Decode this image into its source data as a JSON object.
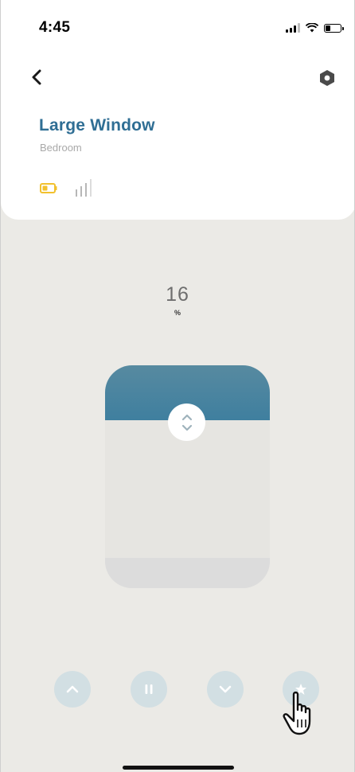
{
  "status_bar": {
    "time": "4:45",
    "battery_level": 0.35
  },
  "header": {
    "back_icon": "chevron-left-icon",
    "settings_icon": "settings-hexagon-icon"
  },
  "device": {
    "name": "Large Window",
    "room": "Bedroom",
    "battery_icon": "battery-low-icon",
    "signal_icon": "signal-strength-icon",
    "battery_color": "#f2c12e",
    "signal_color": "#b7b7b7"
  },
  "position": {
    "value": "16",
    "unit": "%",
    "fraction": 0.16
  },
  "shade": {
    "open_color": "#3f7f9f",
    "closed_color": "#e6e5e1",
    "handle_icon": "up-down-arrows-icon"
  },
  "controls": {
    "up_icon": "chevron-up-icon",
    "pause_icon": "pause-icon",
    "down_icon": "chevron-down-icon",
    "favorite_icon": "star-icon",
    "button_color": "#d2dfe3"
  },
  "colors": {
    "accent": "#2f6e94",
    "background": "#ebeae6",
    "card": "#ffffff"
  }
}
